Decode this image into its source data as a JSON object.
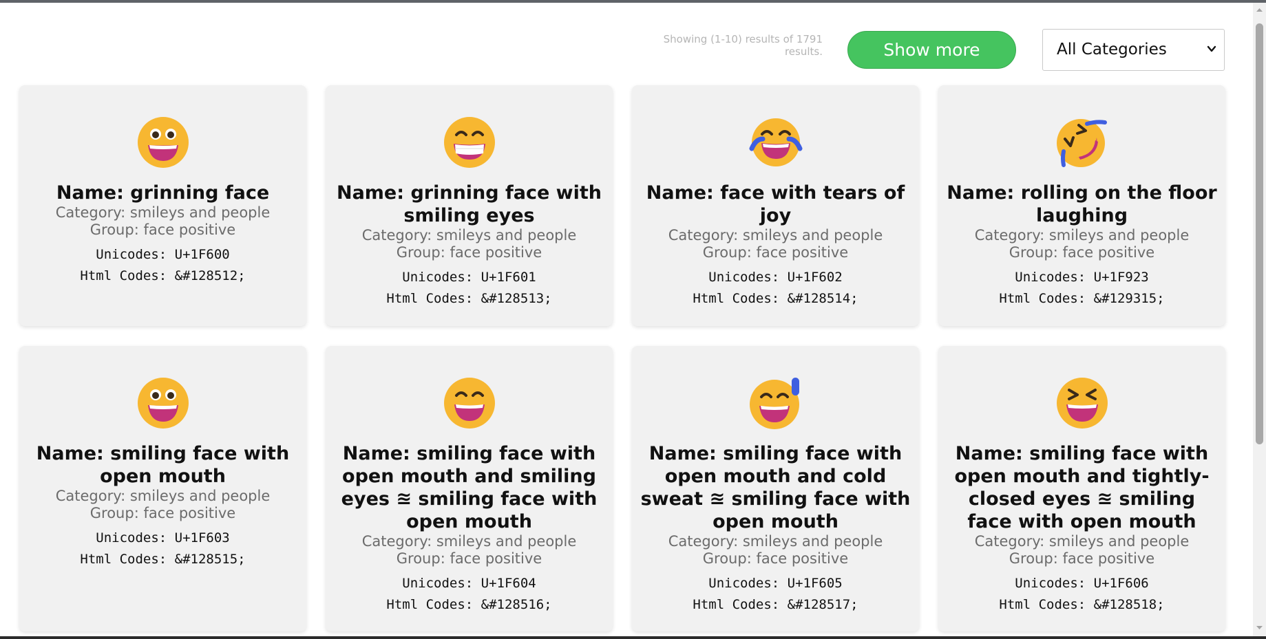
{
  "toolbar": {
    "results_text": "Showing (1-10) results of 1791 results.",
    "show_more_label": "Show more",
    "category_select": "All Categories"
  },
  "colors": {
    "accent_green": "#45c45f",
    "card_bg": "#f1f1f1",
    "emoji_yellow": "#f7b731",
    "emoji_mouth": "#c2337a"
  },
  "cards": [
    {
      "icon": "grinning-face-icon",
      "name": "Name: grinning face",
      "category": "Category: smileys and people",
      "group": "Group: face positive",
      "unicodes": "Unicodes: U+1F600",
      "html_codes": "Html Codes: &#128512;"
    },
    {
      "icon": "grinning-face-with-smiling-eyes-icon",
      "name": "Name: grinning face with smiling eyes",
      "category": "Category: smileys and people",
      "group": "Group: face positive",
      "unicodes": "Unicodes: U+1F601",
      "html_codes": "Html Codes: &#128513;"
    },
    {
      "icon": "face-with-tears-of-joy-icon",
      "name": "Name: face with tears of joy",
      "category": "Category: smileys and people",
      "group": "Group: face positive",
      "unicodes": "Unicodes: U+1F602",
      "html_codes": "Html Codes: &#128514;"
    },
    {
      "icon": "rolling-on-the-floor-laughing-icon",
      "name": "Name: rolling on the floor laughing",
      "category": "Category: smileys and people",
      "group": "Group: face positive",
      "unicodes": "Unicodes: U+1F923",
      "html_codes": "Html Codes: &#129315;"
    },
    {
      "icon": "smiling-face-with-open-mouth-icon",
      "name": "Name: smiling face with open mouth",
      "category": "Category: smileys and people",
      "group": "Group: face positive",
      "unicodes": "Unicodes: U+1F603",
      "html_codes": "Html Codes: &#128515;"
    },
    {
      "icon": "smiling-face-open-mouth-smiling-eyes-icon",
      "name": "Name: smiling face with open mouth and smiling eyes ≊ smiling face with open mouth",
      "category": "Category: smileys and people",
      "group": "Group: face positive",
      "unicodes": "Unicodes: U+1F604",
      "html_codes": "Html Codes: &#128516;"
    },
    {
      "icon": "smiling-face-open-mouth-cold-sweat-icon",
      "name": "Name: smiling face with open mouth and cold sweat ≊ smiling face with open mouth",
      "category": "Category: smileys and people",
      "group": "Group: face positive",
      "unicodes": "Unicodes: U+1F605",
      "html_codes": "Html Codes: &#128517;"
    },
    {
      "icon": "smiling-face-open-mouth-tightly-closed-eyes-icon",
      "name": "Name: smiling face with open mouth and tightly-closed eyes ≊ smiling face with open mouth",
      "category": "Category: smileys and people",
      "group": "Group: face positive",
      "unicodes": "Unicodes: U+1F606",
      "html_codes": "Html Codes: &#128518;"
    }
  ]
}
